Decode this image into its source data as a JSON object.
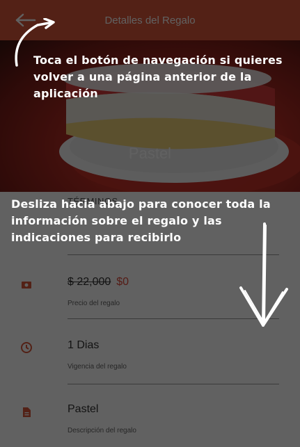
{
  "appbar": {
    "title": "Detalles del Regalo",
    "back_icon": "arrow-left-icon"
  },
  "hero": {
    "title": "Pastel"
  },
  "details": {
    "section_title": "TÉRMINOS",
    "price": {
      "old": "$ 22,000",
      "new": "$0",
      "label": "Precio del regalo",
      "icon": "money-icon"
    },
    "validity": {
      "value": "1 Dias",
      "label": "Vigencia del regalo",
      "icon": "clock-icon"
    },
    "description": {
      "value": "Pastel",
      "label": "Descripción del regalo",
      "icon": "document-icon"
    }
  },
  "coachmarks": {
    "nav_tip": "Toca el botón de navegación si quieres volver a una página anterior de la aplicación",
    "scroll_tip": "Desliza hacia abajo para conocer toda la información sobre el regalo y las indicaciones para recibirlo"
  },
  "colors": {
    "primary": "#d9573a",
    "accent": "#e04a3a",
    "overlay": "rgba(0,0,0,0.62)"
  }
}
